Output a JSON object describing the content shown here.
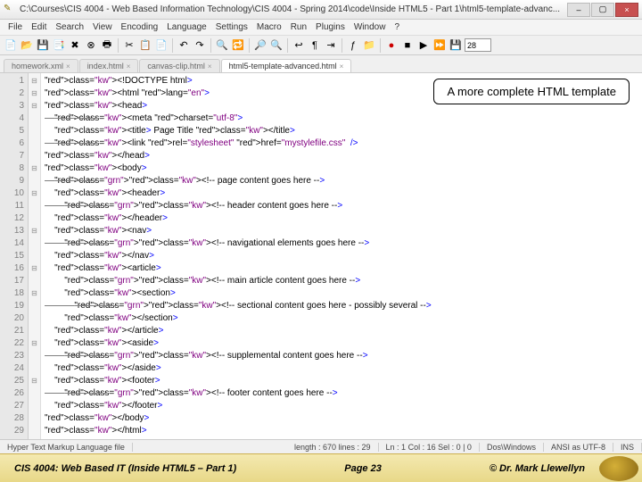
{
  "window": {
    "path": "C:\\Courses\\CIS 4004 - Web Based Information Technology\\CIS 4004 - Spring 2014\\code\\Inside HTML5 - Part 1\\html5-template-advanc..."
  },
  "winbtns": {
    "min": "–",
    "max": "▢",
    "close": "×"
  },
  "menu": [
    "File",
    "Edit",
    "Search",
    "View",
    "Encoding",
    "Language",
    "Settings",
    "Macro",
    "Run",
    "Plugins",
    "Window",
    "?"
  ],
  "spinval": "28",
  "tabs": [
    {
      "label": "homework.xml",
      "active": false
    },
    {
      "label": "index.html",
      "active": false
    },
    {
      "label": "canvas-clip.html",
      "active": false
    },
    {
      "label": "html5-template-advanced.html",
      "active": true
    }
  ],
  "callout": "A more complete HTML template",
  "lines": [
    {
      "n": 1,
      "f": "⊟",
      "t": "<!DOCTYPE html>"
    },
    {
      "n": 2,
      "f": "⊟",
      "t": "<html lang=\"en\">"
    },
    {
      "n": 3,
      "f": "⊟",
      "t": "<head>"
    },
    {
      "n": 4,
      "f": "",
      "t": "    <meta charset=\"utf-8\">",
      "strike": true
    },
    {
      "n": 5,
      "f": "",
      "t": "    <title> Page Title </title>"
    },
    {
      "n": 6,
      "f": "",
      "t": "    <link rel=\"stylesheet\" href=\"mystylefile.css\"  />",
      "strike": true
    },
    {
      "n": 7,
      "f": "",
      "t": "</head>"
    },
    {
      "n": 8,
      "f": "⊟",
      "t": "<body>"
    },
    {
      "n": 9,
      "f": "",
      "t": "    <!-- page content goes here -->",
      "strike": true
    },
    {
      "n": 10,
      "f": "⊟",
      "t": "    <header>"
    },
    {
      "n": 11,
      "f": "",
      "t": "        <!-- header content goes here -->",
      "strike": true
    },
    {
      "n": 12,
      "f": "",
      "t": "    </header>"
    },
    {
      "n": 13,
      "f": "⊟",
      "t": "    <nav>"
    },
    {
      "n": 14,
      "f": "",
      "t": "        <!-- navigational elements goes here -->",
      "strike": true
    },
    {
      "n": 15,
      "f": "",
      "t": "    </nav>"
    },
    {
      "n": 16,
      "f": "⊟",
      "t": "    <article>"
    },
    {
      "n": 17,
      "f": "",
      "t": "        <!-- main article content goes here -->"
    },
    {
      "n": 18,
      "f": "⊟",
      "t": "        <section>"
    },
    {
      "n": 19,
      "f": "",
      "t": "            <!-- sectional content goes here - possibly several -->",
      "strike": true
    },
    {
      "n": 20,
      "f": "",
      "t": "        </section>"
    },
    {
      "n": 21,
      "f": "",
      "t": "    </article>"
    },
    {
      "n": 22,
      "f": "⊟",
      "t": "    <aside>"
    },
    {
      "n": 23,
      "f": "",
      "t": "        <!-- supplemental content goes here -->",
      "strike": true
    },
    {
      "n": 24,
      "f": "",
      "t": "    </aside>"
    },
    {
      "n": 25,
      "f": "⊟",
      "t": "    <footer>"
    },
    {
      "n": 26,
      "f": "",
      "t": "        <!-- footer content goes here -->",
      "strike": true
    },
    {
      "n": 27,
      "f": "",
      "t": "    </footer>"
    },
    {
      "n": 28,
      "f": "",
      "t": "</body>"
    },
    {
      "n": 29,
      "f": "",
      "t": "</html>"
    }
  ],
  "status": {
    "lang": "Hyper Text Markup Language file",
    "len": "length : 670   lines : 29",
    "pos": "Ln : 1   Col : 16   Sel : 0 | 0",
    "eol": "Dos\\Windows",
    "enc": "ANSI as UTF-8",
    "mode": "INS"
  },
  "footer": {
    "course": "CIS 4004: Web Based IT (Inside HTML5 – Part 1)",
    "page": "Page 23",
    "author": "© Dr. Mark Llewellyn"
  }
}
